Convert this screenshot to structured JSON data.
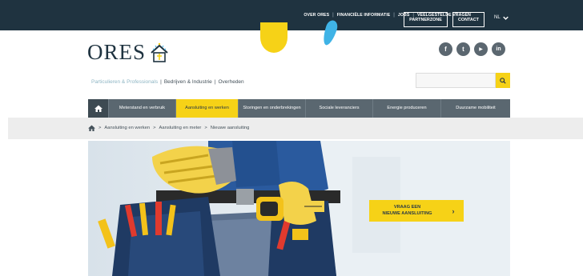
{
  "topbar": {
    "links": [
      "OVER ORES",
      "FINANCIËLE INFORMATIE",
      "JOBS",
      "VEELGESTELDE VRAGEN"
    ],
    "partner_label": "PARTNERZONE",
    "contact_label": "CONTACT",
    "language": "NL"
  },
  "logo": {
    "text": "ORES"
  },
  "social": [
    {
      "icon": "facebook-icon",
      "glyph": "f"
    },
    {
      "icon": "twitter-icon",
      "glyph": "t"
    },
    {
      "icon": "youtube-icon",
      "glyph": "▶"
    },
    {
      "icon": "linkedin-icon",
      "glyph": "in"
    }
  ],
  "segments": {
    "items": [
      "Particulieren & Professionals",
      "Bedrijven & Industrie",
      "Overheden"
    ],
    "separator": "|"
  },
  "search": {
    "placeholder": "",
    "value": ""
  },
  "nav": {
    "items": [
      "Meterstand en verbruik",
      "Aansluiting en werken",
      "Storingen en onderbrekingen",
      "Sociale leveranciers",
      "Energie produceren",
      "Duurzame mobiliteit"
    ],
    "active_index": 1
  },
  "breadcrumb": {
    "items": [
      "Aansluiting en werken",
      "Aansluiting en meter",
      "Nieuwe aansluiting"
    ],
    "separator": ">"
  },
  "hero": {
    "cta_label": "VRAAG EEN\nNIEUWE AANSLUITING",
    "cta_arrow": "›"
  },
  "colors": {
    "topbar": "#1f3340",
    "accent": "#f6d217",
    "nav": "#5a6770",
    "blob_blue": "#3fb3e6"
  }
}
